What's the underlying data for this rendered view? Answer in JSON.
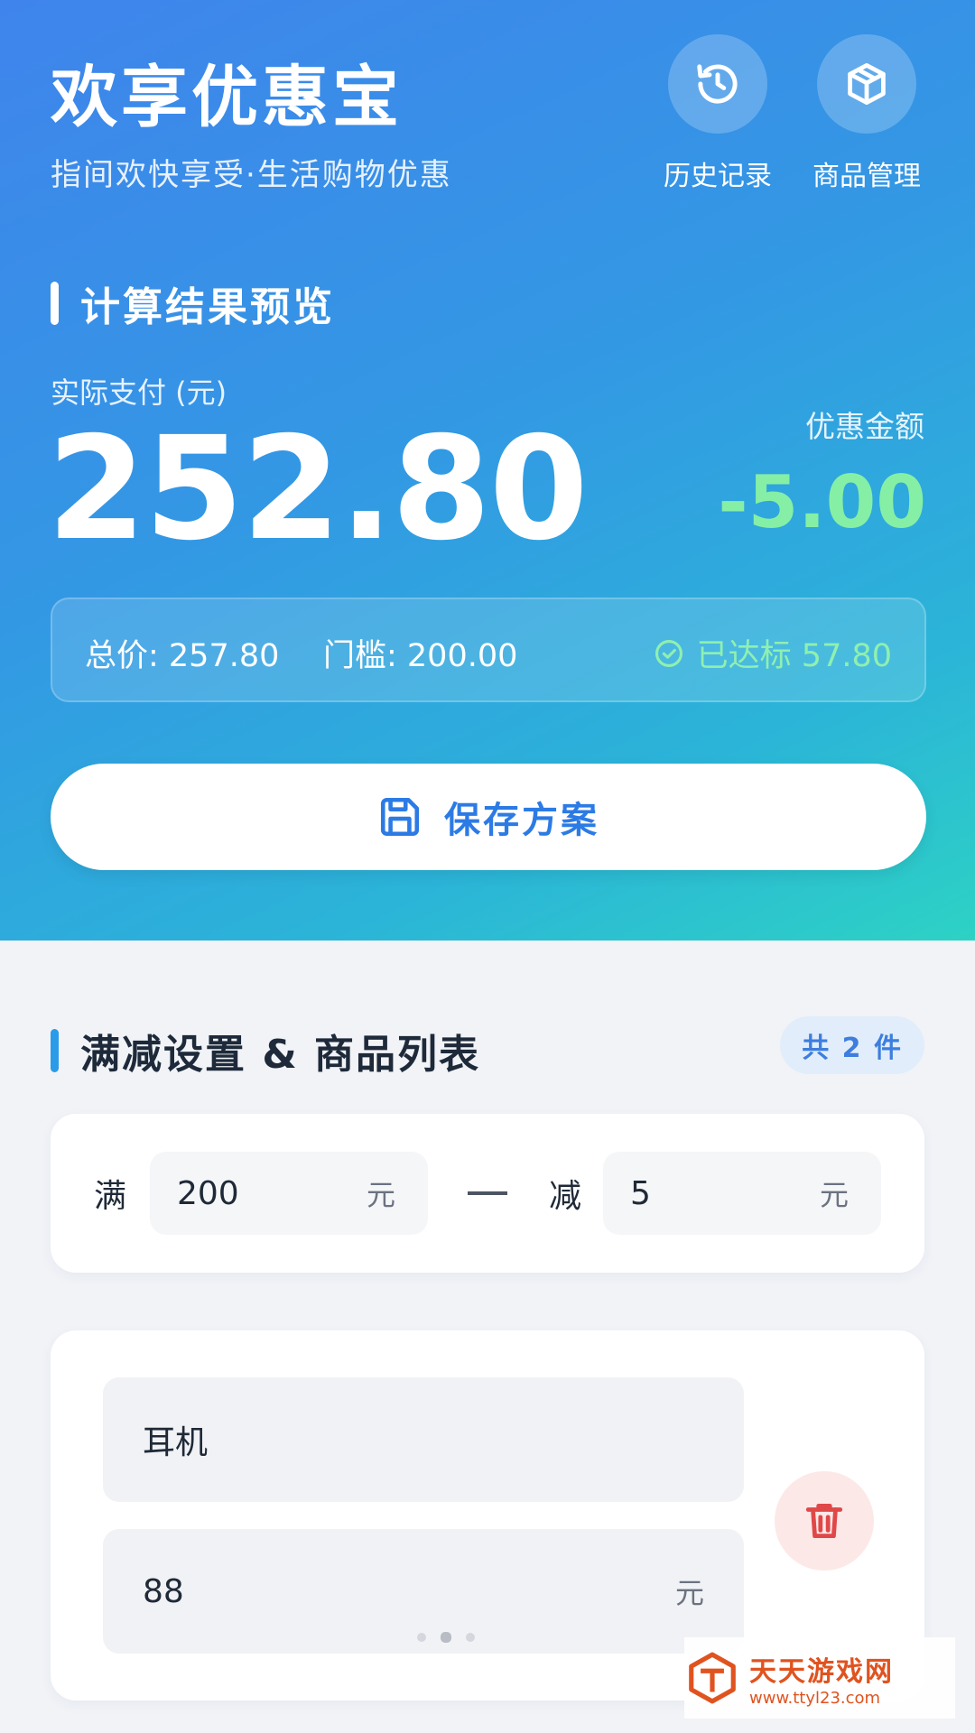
{
  "header": {
    "title": "欢享优惠宝",
    "subtitle": "指间欢快享受·生活购物优惠",
    "actions": [
      {
        "label": "历史记录",
        "icon": "history-icon"
      },
      {
        "label": "商品管理",
        "icon": "box-icon"
      }
    ]
  },
  "preview": {
    "section_title": "计算结果预览",
    "pay_label": "实际支付 (元)",
    "pay_amount": "252.80",
    "discount_label": "优惠金额",
    "discount_amount": "-5.00",
    "total_text": "总价: 257.80",
    "threshold_text": "门槛: 200.00",
    "reached_text": "已达标 57.80",
    "save_label": "保存方案"
  },
  "list": {
    "section_title": "满减设置 & 商品列表",
    "count_badge": "共 2 件",
    "rule": {
      "full_word": "满",
      "full_value": "200",
      "full_unit": "元",
      "minus_word": "减",
      "minus_value": "5",
      "minus_unit": "元"
    },
    "items": [
      {
        "name": "耳机",
        "price": "88",
        "price_unit": "元"
      }
    ]
  },
  "watermark": {
    "name": "天天游戏网",
    "url": "www.ttyl23.com"
  },
  "colors": {
    "header_gradient_start": "#3f84ec",
    "header_gradient_end": "#2dd2c4",
    "discount_green": "#86efa6",
    "primary_blue": "#2c7be5",
    "delete_red": "#e04848"
  }
}
